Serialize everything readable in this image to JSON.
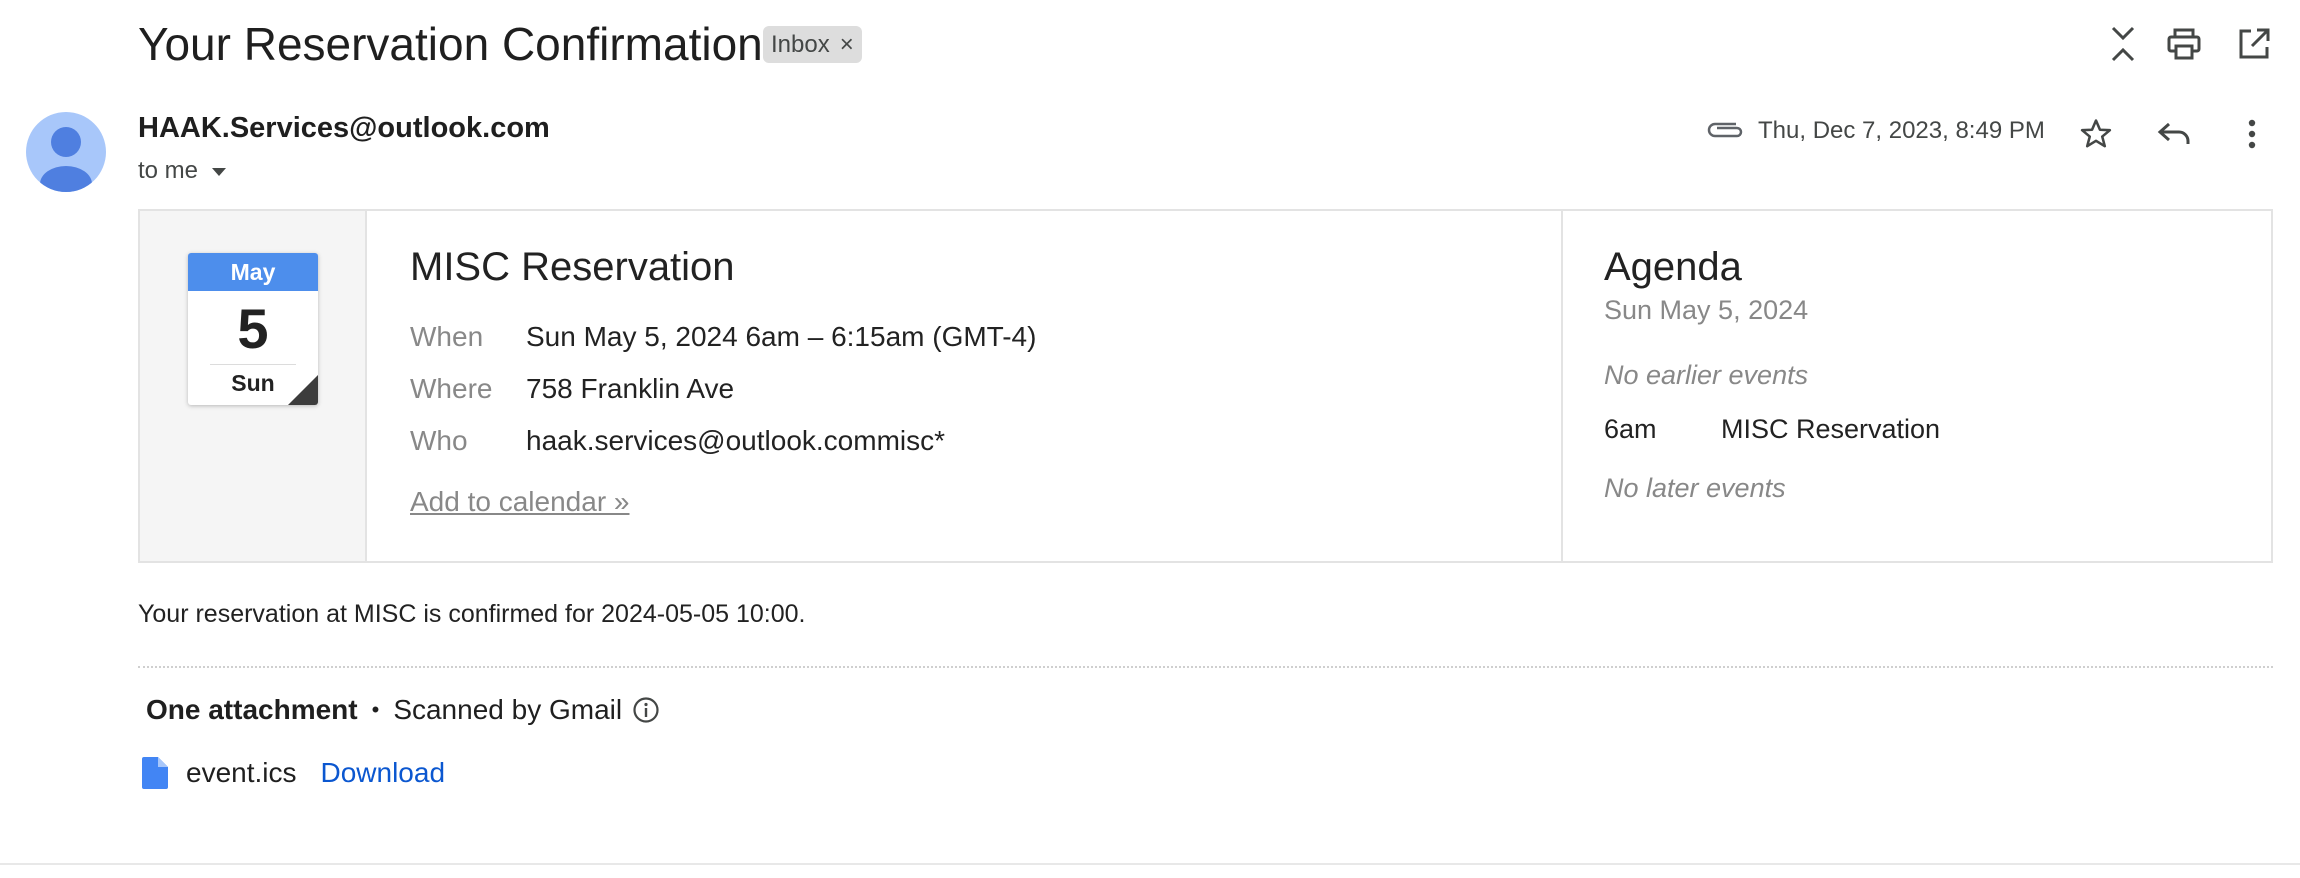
{
  "header": {
    "subject": "Your Reservation Confirmation",
    "label": "Inbox",
    "label_remove": "×"
  },
  "sender": {
    "email": "HAAK.Services@outlook.com",
    "to": "to me",
    "date": "Thu, Dec 7, 2023, 8:49 PM"
  },
  "invite": {
    "month": "May",
    "day": "5",
    "weekday": "Sun",
    "title": "MISC Reservation",
    "when_label": "When",
    "when_value": "Sun May 5, 2024 6am – 6:15am (GMT-4)",
    "where_label": "Where",
    "where_value": "758 Franklin Ave",
    "who_label": "Who",
    "who_value": "haak.services@outlook.commisc*",
    "add_to_calendar": "Add to calendar »"
  },
  "agenda": {
    "title": "Agenda",
    "date": "Sun May 5, 2024",
    "no_earlier": "No earlier events",
    "event_time": "6am",
    "event_title": "MISC Reservation",
    "no_later": "No later events"
  },
  "message": {
    "body": "Your reservation at MISC is confirmed for 2024-05-05 10:00."
  },
  "attachments": {
    "heading": "One attachment",
    "separator": "•",
    "scanned": "Scanned by Gmail",
    "file_name": "event.ics",
    "download": "Download"
  },
  "icons": {
    "collapse": "collapse-all-icon",
    "print": "print-icon",
    "open_new_window": "open-in-new-window-icon",
    "attachment": "paperclip-icon",
    "star": "star-icon",
    "reply": "reply-icon",
    "more": "more-vert-icon",
    "info": "info-icon",
    "file": "file-icon",
    "dropdown": "caret-down-icon"
  },
  "colors": {
    "calendar_month": "#4d8eec",
    "link": "#0b57d0",
    "avatar": "#a8c7fa",
    "avatar_figure": "#4f7fe0"
  }
}
